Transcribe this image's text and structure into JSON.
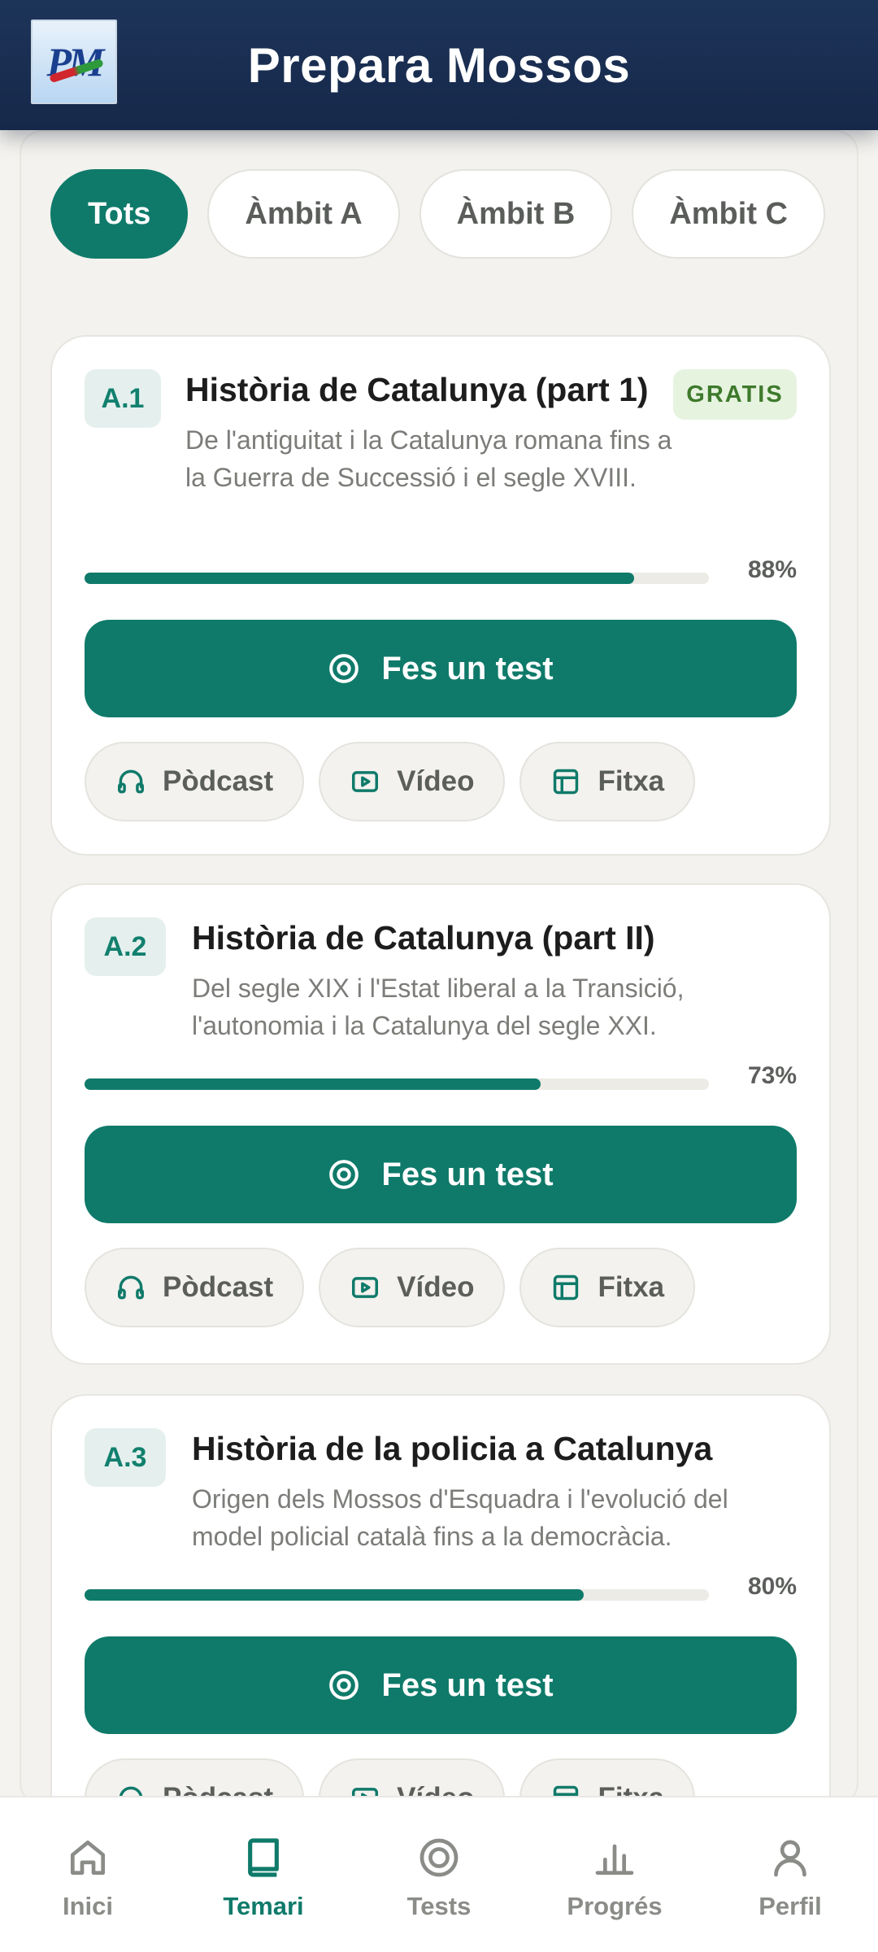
{
  "header": {
    "app_title": "Prepara Mossos",
    "logo_text": "PM"
  },
  "filters": [
    {
      "label": "Tots",
      "active": true
    },
    {
      "label": "Àmbit A",
      "active": false
    },
    {
      "label": "Àmbit B",
      "active": false
    },
    {
      "label": "Àmbit C",
      "active": false
    }
  ],
  "topics": [
    {
      "code": "A.1",
      "title": "Història de Catalunya (part 1)",
      "description": "De l'antiguitat i la Catalunya romana fins a la Guerra de Successió i el segle XVIII.",
      "badge": "GRATIS",
      "progress": 88,
      "progress_label": "88%",
      "test_label": "Fes un test",
      "resources": [
        {
          "label": "Pòdcast",
          "icon": "headphones-icon"
        },
        {
          "label": "Vídeo",
          "icon": "video-icon"
        },
        {
          "label": "Fitxa",
          "icon": "layout-icon"
        }
      ]
    },
    {
      "code": "A.2",
      "title": "Història de Catalunya (part II)",
      "description": "Del segle XIX i l'Estat liberal a la Transició, l'autonomia i la Catalunya del segle XXI.",
      "progress": 73,
      "progress_label": "73%",
      "test_label": "Fes un test",
      "resources": [
        {
          "label": "Pòdcast",
          "icon": "headphones-icon"
        },
        {
          "label": "Vídeo",
          "icon": "video-icon"
        },
        {
          "label": "Fitxa",
          "icon": "layout-icon"
        }
      ]
    },
    {
      "code": "A.3",
      "title": "Història de la policia a Catalunya",
      "description": "Origen dels Mossos d'Esquadra i l'evolució del model policial català fins a la democràcia.",
      "progress": 80,
      "progress_label": "80%",
      "test_label": "Fes un test",
      "resources": [
        {
          "label": "Pòdcast",
          "icon": "headphones-icon"
        },
        {
          "label": "Vídeo",
          "icon": "video-icon"
        },
        {
          "label": "Fitxa",
          "icon": "layout-icon"
        }
      ]
    }
  ],
  "nav": [
    {
      "label": "Inici",
      "icon": "home-icon",
      "active": false
    },
    {
      "label": "Temari",
      "icon": "book-icon",
      "active": true
    },
    {
      "label": "Tests",
      "icon": "target-icon",
      "active": false
    },
    {
      "label": "Progrés",
      "icon": "bar-chart-icon",
      "active": false
    },
    {
      "label": "Perfil",
      "icon": "user-icon",
      "active": false
    }
  ],
  "colors": {
    "accent": "#0f7a6a",
    "header": "#1d3459",
    "badge_free": "#3e7a2c"
  }
}
